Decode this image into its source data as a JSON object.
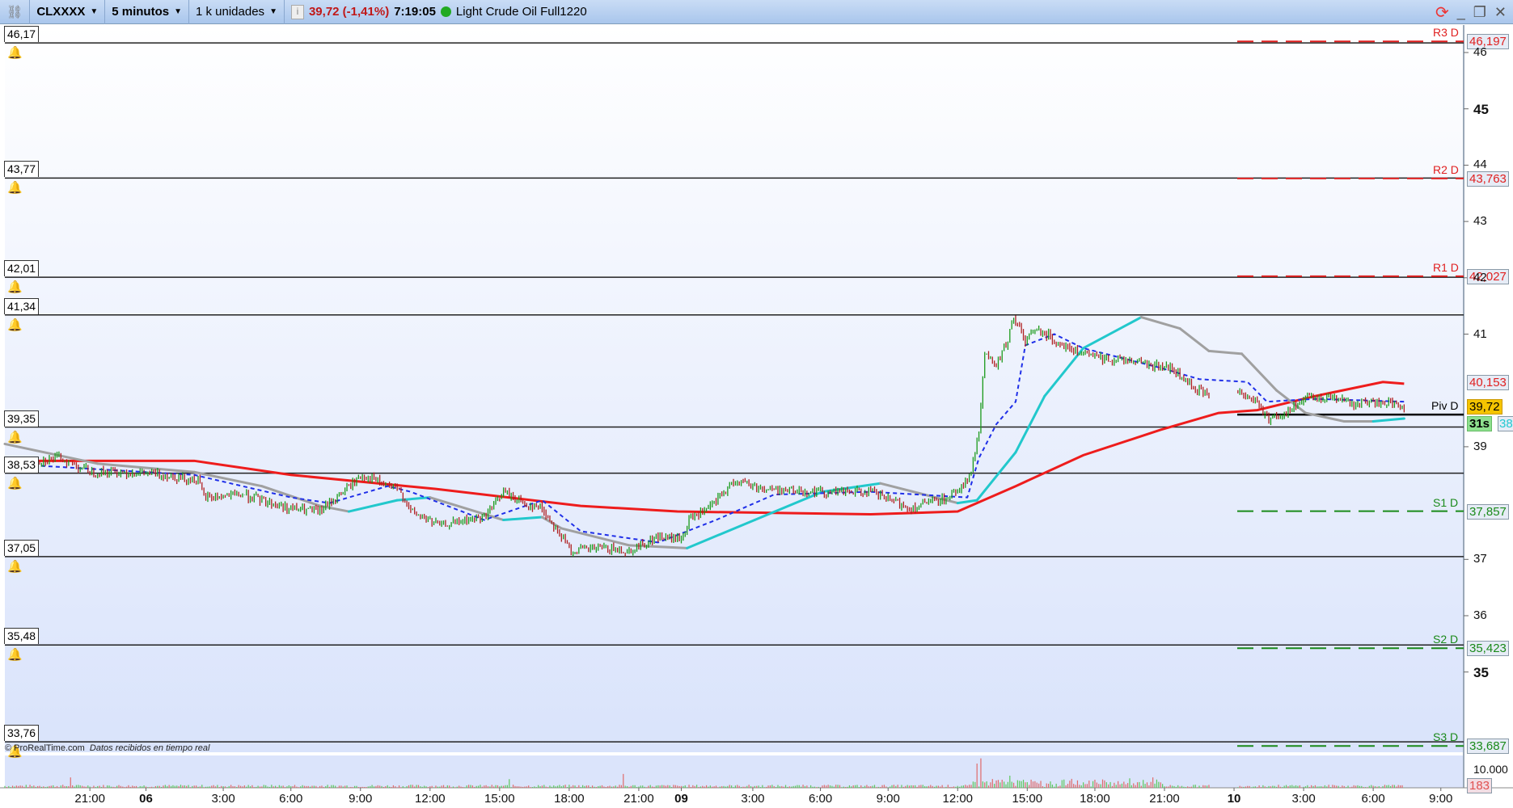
{
  "toolbar": {
    "symbol": "CLXXXX",
    "timeframe": "5 minutos",
    "units": "1 k unidades",
    "price_change": "39,72 (-1,41%)",
    "time": "7:19:05",
    "instrument": "Light Crude Oil Full1220",
    "status_color": "#22aa22"
  },
  "footer": {
    "copyright": "© ProRealTime.com",
    "status": "Datos recibidos en tiempo real"
  },
  "levels": [
    {
      "label": "46,17",
      "price": 46.17
    },
    {
      "label": "43,77",
      "price": 43.77
    },
    {
      "label": "42,01",
      "price": 42.01
    },
    {
      "label": "41,34",
      "price": 41.34
    },
    {
      "label": "39,35",
      "price": 39.35
    },
    {
      "label": "38,53",
      "price": 38.53
    },
    {
      "label": "37,05",
      "price": 37.05
    },
    {
      "label": "35,48",
      "price": 35.48
    },
    {
      "label": "33,76",
      "price": 33.76
    }
  ],
  "pivots": [
    {
      "name": "R3 D",
      "value": "46,197",
      "price": 46.197,
      "color": "#e02020"
    },
    {
      "name": "R2 D",
      "value": "43,763",
      "price": 43.763,
      "color": "#e02020"
    },
    {
      "name": "R1 D",
      "value": "42,027",
      "price": 42.027,
      "color": "#e02020"
    },
    {
      "name": "Piv D",
      "price": 39.57,
      "color": "#000000"
    },
    {
      "name": "S1 D",
      "value": "37,857",
      "price": 37.857,
      "color": "#1a8a1a"
    },
    {
      "name": "S2 D",
      "value": "35,423",
      "price": 35.423,
      "color": "#1a8a1a"
    },
    {
      "name": "S3 D",
      "value": "33,687",
      "price": 33.687,
      "color": "#1a8a1a"
    }
  ],
  "axis_labels": {
    "ma_value": "40,153",
    "last_price": "39,72",
    "countdown": "31s",
    "cyan_value": "38",
    "volume_tick": "10.000",
    "last_volume": "183"
  },
  "chart_data": {
    "type": "candlestick",
    "ylim": [
      33.4,
      46.4
    ],
    "yticks": [
      {
        "v": 46,
        "t": "46"
      },
      {
        "v": 45,
        "t": "45",
        "bold": true
      },
      {
        "v": 44,
        "t": "44"
      },
      {
        "v": 43,
        "t": "43"
      },
      {
        "v": 42,
        "t": "42"
      },
      {
        "v": 41,
        "t": "41"
      },
      {
        "v": 39,
        "t": "39"
      },
      {
        "v": 37,
        "t": "37"
      },
      {
        "v": 36,
        "t": "36"
      },
      {
        "v": 35,
        "t": "35",
        "bold": true
      }
    ],
    "xticks": [
      {
        "bar": 44,
        "t": "21:00"
      },
      {
        "bar": 73,
        "t": "06",
        "bold": true
      },
      {
        "bar": 113,
        "t": "3:00"
      },
      {
        "bar": 148,
        "t": "6:00"
      },
      {
        "bar": 184,
        "t": "9:00"
      },
      {
        "bar": 220,
        "t": "12:00"
      },
      {
        "bar": 256,
        "t": "15:00"
      },
      {
        "bar": 292,
        "t": "18:00"
      },
      {
        "bar": 328,
        "t": "21:00"
      },
      {
        "bar": 350,
        "t": "09",
        "bold": true
      },
      {
        "bar": 387,
        "t": "3:00"
      },
      {
        "bar": 422,
        "t": "6:00"
      },
      {
        "bar": 457,
        "t": "9:00"
      },
      {
        "bar": 493,
        "t": "12:00"
      },
      {
        "bar": 529,
        "t": "15:00"
      },
      {
        "bar": 564,
        "t": "18:00"
      },
      {
        "bar": 600,
        "t": "21:00"
      },
      {
        "bar": 636,
        "t": "10",
        "bold": true
      },
      {
        "bar": 672,
        "t": "3:00"
      },
      {
        "bar": 708,
        "t": "6:00"
      },
      {
        "bar": 743,
        "t": "9:00"
      }
    ],
    "price": [
      [
        0,
        38.7
      ],
      [
        18,
        38.75
      ],
      [
        28,
        38.8
      ],
      [
        45,
        38.55
      ],
      [
        63,
        38.55
      ],
      [
        83,
        38.5
      ],
      [
        100,
        38.4
      ],
      [
        103,
        38.1
      ],
      [
        123,
        38.15
      ],
      [
        148,
        37.9
      ],
      [
        163,
        37.85
      ],
      [
        175,
        38.2
      ],
      [
        185,
        38.5
      ],
      [
        195,
        38.35
      ],
      [
        205,
        38.2
      ],
      [
        210,
        37.85
      ],
      [
        225,
        37.6
      ],
      [
        248,
        37.75
      ],
      [
        258,
        38.2
      ],
      [
        268,
        38.0
      ],
      [
        278,
        37.9
      ],
      [
        293,
        37.15
      ],
      [
        308,
        37.2
      ],
      [
        323,
        37.15
      ],
      [
        338,
        37.4
      ],
      [
        350,
        37.35
      ],
      [
        355,
        37.75
      ],
      [
        363,
        37.85
      ],
      [
        378,
        38.4
      ],
      [
        393,
        38.25
      ],
      [
        423,
        38.2
      ],
      [
        448,
        38.2
      ],
      [
        468,
        37.9
      ],
      [
        488,
        38.1
      ],
      [
        495,
        38.3
      ],
      [
        500,
        38.5
      ],
      [
        504,
        39.3
      ],
      [
        507,
        40.7
      ],
      [
        512,
        40.4
      ],
      [
        518,
        40.8
      ],
      [
        522,
        41.3
      ],
      [
        528,
        40.9
      ],
      [
        535,
        41.1
      ],
      [
        543,
        40.9
      ],
      [
        553,
        40.7
      ],
      [
        563,
        40.6
      ],
      [
        573,
        40.55
      ],
      [
        583,
        40.55
      ],
      [
        593,
        40.45
      ],
      [
        603,
        40.4
      ],
      [
        613,
        40.1
      ],
      [
        623,
        39.9
      ],
      [
        null,
        null
      ],
      [
        638,
        40.0
      ],
      [
        648,
        39.8
      ],
      [
        653,
        39.5
      ],
      [
        663,
        39.6
      ],
      [
        673,
        39.85
      ],
      [
        688,
        39.9
      ],
      [
        698,
        39.75
      ],
      [
        713,
        39.8
      ],
      [
        724,
        39.72
      ]
    ],
    "ma_red": [
      [
        0,
        38.75
      ],
      [
        98,
        38.75
      ],
      [
        148,
        38.5
      ],
      [
        223,
        38.25
      ],
      [
        298,
        37.95
      ],
      [
        348,
        37.85
      ],
      [
        448,
        37.8
      ],
      [
        493,
        37.85
      ],
      [
        523,
        38.3
      ],
      [
        558,
        38.85
      ],
      [
        598,
        39.3
      ],
      [
        628,
        39.6
      ],
      [
        648,
        39.65
      ],
      [
        678,
        39.9
      ],
      [
        713,
        40.15
      ],
      [
        724,
        40.12
      ]
    ],
    "ma_grey_cyan": [
      [
        0,
        39.05
      ],
      [
        48,
        38.7
      ],
      [
        98,
        38.55
      ],
      [
        133,
        38.3
      ],
      [
        163,
        37.95
      ],
      [
        178,
        37.85
      ],
      [
        203,
        38.05
      ],
      [
        220,
        38.1
      ],
      [
        258,
        37.7
      ],
      [
        278,
        37.75
      ],
      [
        288,
        37.55
      ],
      [
        323,
        37.25
      ],
      [
        353,
        37.2
      ],
      [
        388,
        37.7
      ],
      [
        423,
        38.2
      ],
      [
        453,
        38.35
      ],
      [
        493,
        38.0
      ],
      [
        503,
        38.05
      ],
      [
        523,
        38.9
      ],
      [
        538,
        39.9
      ],
      [
        558,
        40.75
      ],
      [
        588,
        41.3
      ],
      [
        608,
        41.1
      ],
      [
        623,
        40.7
      ],
      [
        640,
        40.65
      ],
      [
        658,
        40.0
      ],
      [
        673,
        39.6
      ],
      [
        693,
        39.45
      ],
      [
        708,
        39.45
      ],
      [
        724,
        39.5
      ]
    ],
    "ma_blue_dashed": [
      [
        0,
        38.7
      ],
      [
        48,
        38.6
      ],
      [
        98,
        38.5
      ],
      [
        148,
        38.1
      ],
      [
        168,
        38.0
      ],
      [
        198,
        38.3
      ],
      [
        210,
        38.2
      ],
      [
        248,
        37.7
      ],
      [
        278,
        38.05
      ],
      [
        298,
        37.5
      ],
      [
        338,
        37.3
      ],
      [
        353,
        37.5
      ],
      [
        368,
        37.7
      ],
      [
        398,
        38.15
      ],
      [
        448,
        38.2
      ],
      [
        498,
        38.1
      ],
      [
        504,
        38.8
      ],
      [
        513,
        39.4
      ],
      [
        523,
        39.8
      ],
      [
        528,
        40.8
      ],
      [
        543,
        41.0
      ],
      [
        558,
        40.75
      ],
      [
        598,
        40.4
      ],
      [
        618,
        40.2
      ],
      [
        643,
        40.15
      ],
      [
        653,
        39.8
      ],
      [
        678,
        39.85
      ],
      [
        724,
        39.8
      ]
    ],
    "volume_spikes": [
      [
        34,
        6000
      ],
      [
        261,
        5000
      ],
      [
        320,
        8000
      ],
      [
        503,
        14000
      ],
      [
        505,
        17000
      ],
      [
        520,
        7000
      ],
      [
        594,
        6000
      ],
      [
        724,
        183
      ]
    ],
    "volume_ylim": [
      0,
      14000
    ]
  }
}
